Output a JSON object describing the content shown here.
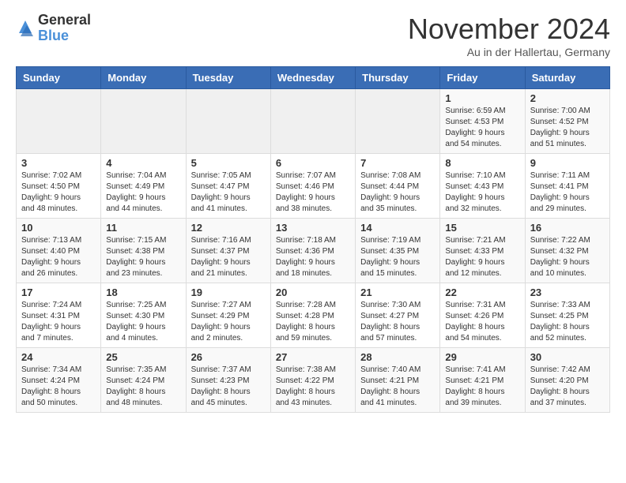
{
  "logo": {
    "general": "General",
    "blue": "Blue"
  },
  "title": "November 2024",
  "location": "Au in der Hallertau, Germany",
  "weekdays": [
    "Sunday",
    "Monday",
    "Tuesday",
    "Wednesday",
    "Thursday",
    "Friday",
    "Saturday"
  ],
  "weeks": [
    [
      {
        "day": "",
        "info": ""
      },
      {
        "day": "",
        "info": ""
      },
      {
        "day": "",
        "info": ""
      },
      {
        "day": "",
        "info": ""
      },
      {
        "day": "",
        "info": ""
      },
      {
        "day": "1",
        "info": "Sunrise: 6:59 AM\nSunset: 4:53 PM\nDaylight: 9 hours\nand 54 minutes."
      },
      {
        "day": "2",
        "info": "Sunrise: 7:00 AM\nSunset: 4:52 PM\nDaylight: 9 hours\nand 51 minutes."
      }
    ],
    [
      {
        "day": "3",
        "info": "Sunrise: 7:02 AM\nSunset: 4:50 PM\nDaylight: 9 hours\nand 48 minutes."
      },
      {
        "day": "4",
        "info": "Sunrise: 7:04 AM\nSunset: 4:49 PM\nDaylight: 9 hours\nand 44 minutes."
      },
      {
        "day": "5",
        "info": "Sunrise: 7:05 AM\nSunset: 4:47 PM\nDaylight: 9 hours\nand 41 minutes."
      },
      {
        "day": "6",
        "info": "Sunrise: 7:07 AM\nSunset: 4:46 PM\nDaylight: 9 hours\nand 38 minutes."
      },
      {
        "day": "7",
        "info": "Sunrise: 7:08 AM\nSunset: 4:44 PM\nDaylight: 9 hours\nand 35 minutes."
      },
      {
        "day": "8",
        "info": "Sunrise: 7:10 AM\nSunset: 4:43 PM\nDaylight: 9 hours\nand 32 minutes."
      },
      {
        "day": "9",
        "info": "Sunrise: 7:11 AM\nSunset: 4:41 PM\nDaylight: 9 hours\nand 29 minutes."
      }
    ],
    [
      {
        "day": "10",
        "info": "Sunrise: 7:13 AM\nSunset: 4:40 PM\nDaylight: 9 hours\nand 26 minutes."
      },
      {
        "day": "11",
        "info": "Sunrise: 7:15 AM\nSunset: 4:38 PM\nDaylight: 9 hours\nand 23 minutes."
      },
      {
        "day": "12",
        "info": "Sunrise: 7:16 AM\nSunset: 4:37 PM\nDaylight: 9 hours\nand 21 minutes."
      },
      {
        "day": "13",
        "info": "Sunrise: 7:18 AM\nSunset: 4:36 PM\nDaylight: 9 hours\nand 18 minutes."
      },
      {
        "day": "14",
        "info": "Sunrise: 7:19 AM\nSunset: 4:35 PM\nDaylight: 9 hours\nand 15 minutes."
      },
      {
        "day": "15",
        "info": "Sunrise: 7:21 AM\nSunset: 4:33 PM\nDaylight: 9 hours\nand 12 minutes."
      },
      {
        "day": "16",
        "info": "Sunrise: 7:22 AM\nSunset: 4:32 PM\nDaylight: 9 hours\nand 10 minutes."
      }
    ],
    [
      {
        "day": "17",
        "info": "Sunrise: 7:24 AM\nSunset: 4:31 PM\nDaylight: 9 hours\nand 7 minutes."
      },
      {
        "day": "18",
        "info": "Sunrise: 7:25 AM\nSunset: 4:30 PM\nDaylight: 9 hours\nand 4 minutes."
      },
      {
        "day": "19",
        "info": "Sunrise: 7:27 AM\nSunset: 4:29 PM\nDaylight: 9 hours\nand 2 minutes."
      },
      {
        "day": "20",
        "info": "Sunrise: 7:28 AM\nSunset: 4:28 PM\nDaylight: 8 hours\nand 59 minutes."
      },
      {
        "day": "21",
        "info": "Sunrise: 7:30 AM\nSunset: 4:27 PM\nDaylight: 8 hours\nand 57 minutes."
      },
      {
        "day": "22",
        "info": "Sunrise: 7:31 AM\nSunset: 4:26 PM\nDaylight: 8 hours\nand 54 minutes."
      },
      {
        "day": "23",
        "info": "Sunrise: 7:33 AM\nSunset: 4:25 PM\nDaylight: 8 hours\nand 52 minutes."
      }
    ],
    [
      {
        "day": "24",
        "info": "Sunrise: 7:34 AM\nSunset: 4:24 PM\nDaylight: 8 hours\nand 50 minutes."
      },
      {
        "day": "25",
        "info": "Sunrise: 7:35 AM\nSunset: 4:24 PM\nDaylight: 8 hours\nand 48 minutes."
      },
      {
        "day": "26",
        "info": "Sunrise: 7:37 AM\nSunset: 4:23 PM\nDaylight: 8 hours\nand 45 minutes."
      },
      {
        "day": "27",
        "info": "Sunrise: 7:38 AM\nSunset: 4:22 PM\nDaylight: 8 hours\nand 43 minutes."
      },
      {
        "day": "28",
        "info": "Sunrise: 7:40 AM\nSunset: 4:21 PM\nDaylight: 8 hours\nand 41 minutes."
      },
      {
        "day": "29",
        "info": "Sunrise: 7:41 AM\nSunset: 4:21 PM\nDaylight: 8 hours\nand 39 minutes."
      },
      {
        "day": "30",
        "info": "Sunrise: 7:42 AM\nSunset: 4:20 PM\nDaylight: 8 hours\nand 37 minutes."
      }
    ]
  ]
}
